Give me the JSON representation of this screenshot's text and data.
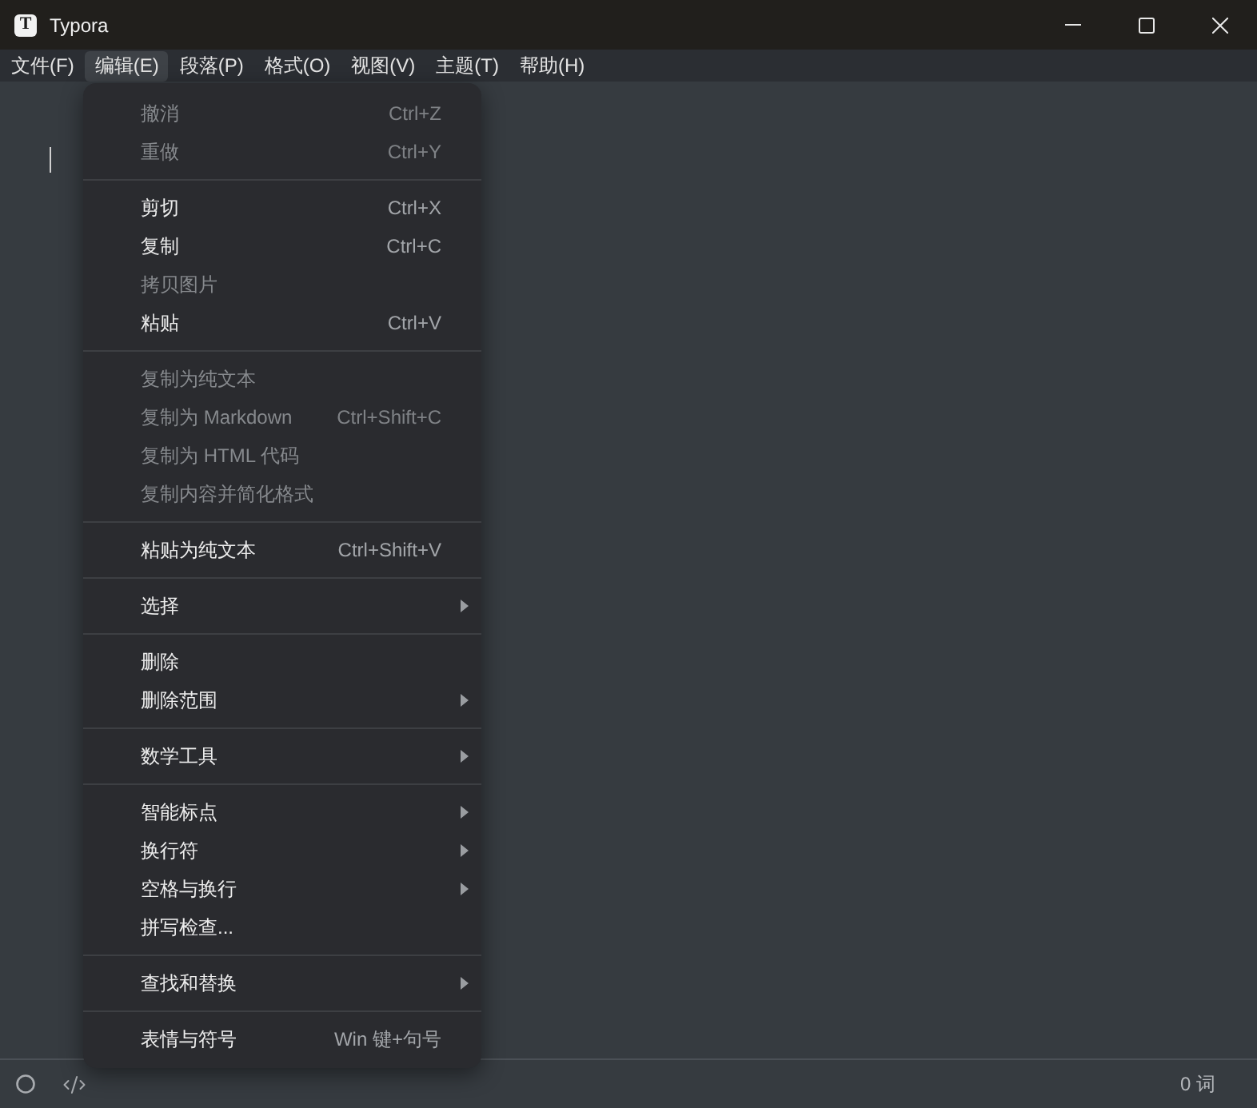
{
  "window": {
    "icon_letter": "T",
    "title": "Typora"
  },
  "menu_bar": [
    {
      "label": "文件(F)",
      "selected": false
    },
    {
      "label": "编辑(E)",
      "selected": true
    },
    {
      "label": "段落(P)",
      "selected": false
    },
    {
      "label": "格式(O)",
      "selected": false
    },
    {
      "label": "视图(V)",
      "selected": false
    },
    {
      "label": "主题(T)",
      "selected": false
    },
    {
      "label": "帮助(H)",
      "selected": false
    }
  ],
  "edit_menu": {
    "sections": [
      {
        "items": [
          {
            "label": "撤消",
            "shortcut": "Ctrl+Z",
            "disabled": true,
            "submenu": false
          },
          {
            "label": "重做",
            "shortcut": "Ctrl+Y",
            "disabled": true,
            "submenu": false
          }
        ]
      },
      {
        "items": [
          {
            "label": "剪切",
            "shortcut": "Ctrl+X",
            "disabled": false,
            "submenu": false
          },
          {
            "label": "复制",
            "shortcut": "Ctrl+C",
            "disabled": false,
            "submenu": false
          },
          {
            "label": "拷贝图片",
            "disabled": true,
            "submenu": false
          },
          {
            "label": "粘贴",
            "shortcut": "Ctrl+V",
            "disabled": false,
            "submenu": false
          }
        ]
      },
      {
        "items": [
          {
            "label": "复制为纯文本",
            "disabled": true,
            "submenu": false
          },
          {
            "label": "复制为 Markdown",
            "shortcut": "Ctrl+Shift+C",
            "disabled": true,
            "submenu": false
          },
          {
            "label": "复制为 HTML 代码",
            "disabled": true,
            "submenu": false
          },
          {
            "label": "复制内容并简化格式",
            "disabled": true,
            "submenu": false
          }
        ]
      },
      {
        "items": [
          {
            "label": "粘贴为纯文本",
            "shortcut": "Ctrl+Shift+V",
            "disabled": false,
            "submenu": false
          }
        ]
      },
      {
        "items": [
          {
            "label": "选择",
            "disabled": false,
            "submenu": true
          }
        ]
      },
      {
        "items": [
          {
            "label": "删除",
            "disabled": false,
            "submenu": false
          },
          {
            "label": "删除范围",
            "disabled": false,
            "submenu": true
          }
        ]
      },
      {
        "items": [
          {
            "label": "数学工具",
            "disabled": false,
            "submenu": true
          }
        ]
      },
      {
        "items": [
          {
            "label": "智能标点",
            "disabled": false,
            "submenu": true
          },
          {
            "label": "换行符",
            "disabled": false,
            "submenu": true
          },
          {
            "label": "空格与换行",
            "disabled": false,
            "submenu": true
          },
          {
            "label": "拼写检查...",
            "disabled": false,
            "submenu": false
          }
        ]
      },
      {
        "items": [
          {
            "label": "查找和替换",
            "disabled": false,
            "submenu": true
          }
        ]
      },
      {
        "items": [
          {
            "label": "表情与符号",
            "shortcut": "Win 键+句号",
            "disabled": false,
            "submenu": false
          }
        ]
      }
    ]
  },
  "status_bar": {
    "word_count": "0 词"
  }
}
